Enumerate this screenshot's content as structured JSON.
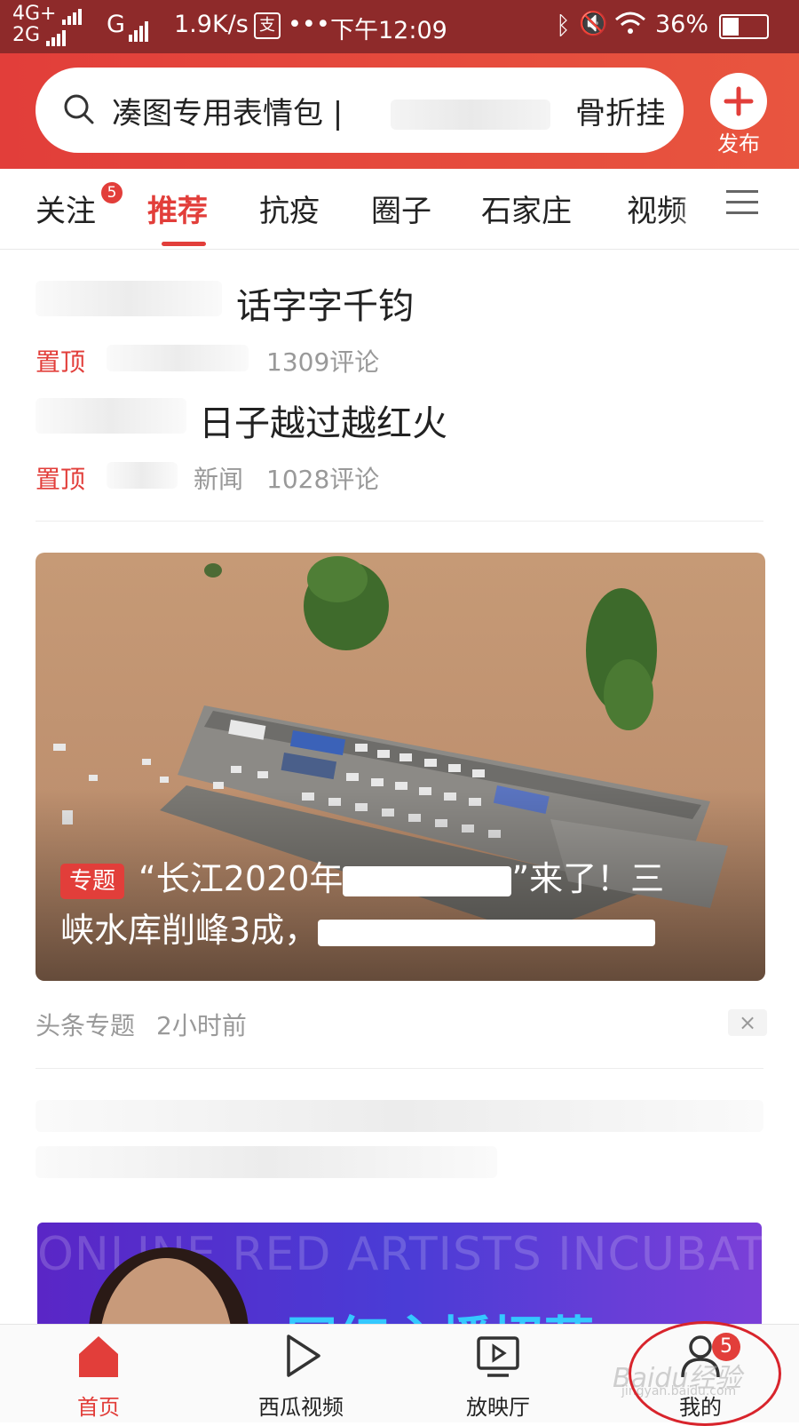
{
  "status_bar": {
    "network1": "4G+",
    "network2": "2G",
    "network3": "G",
    "speed": "1.9K/s",
    "more": "•••",
    "time": "下午12:09",
    "battery": "36%"
  },
  "header": {
    "search_text": "凑图专用表情包 |",
    "search_hot": "骨折挂",
    "publish_label": "发布"
  },
  "tabs": {
    "items": [
      {
        "label": "关注"
      },
      {
        "label": "推荐"
      },
      {
        "label": "抗疫"
      },
      {
        "label": "圈子"
      },
      {
        "label": "石家庄"
      },
      {
        "label": "视频"
      }
    ],
    "follow_badge": "5",
    "active_index": 1
  },
  "news": [
    {
      "title": "话字字千钧",
      "pin_label": "置顶",
      "source": "",
      "comments": "1309评论"
    },
    {
      "title": "日子越过越红火",
      "pin_label": "置顶",
      "source": "新闻",
      "comments": "1028评论"
    }
  ],
  "feature": {
    "badge": "专题",
    "title_part1": "“长江2020年",
    "title_part2": "”来了！三",
    "title_line2": "峡水库削峰3成，",
    "source": "头条专题",
    "time": "2小时前",
    "dismiss_label": "×"
  },
  "ad": {
    "bg_text": "ONLINE RED ARTISTS INCUBATION PLATFORM",
    "headline": "网红主播招募"
  },
  "bottom_nav": {
    "items": [
      {
        "label": "首页",
        "icon": "home-icon"
      },
      {
        "label": "西瓜视频",
        "icon": "play-icon"
      },
      {
        "label": "放映厅",
        "icon": "tv-icon"
      },
      {
        "label": "我的",
        "icon": "user-icon"
      }
    ],
    "mine_badge": "5",
    "watermark": "Baidu经验",
    "watermark_url": "jingyan.baidu.com"
  },
  "colors": {
    "accent": "#e23e3a",
    "status_bar": "#8e2a2a",
    "annotation": "#d8242c"
  }
}
